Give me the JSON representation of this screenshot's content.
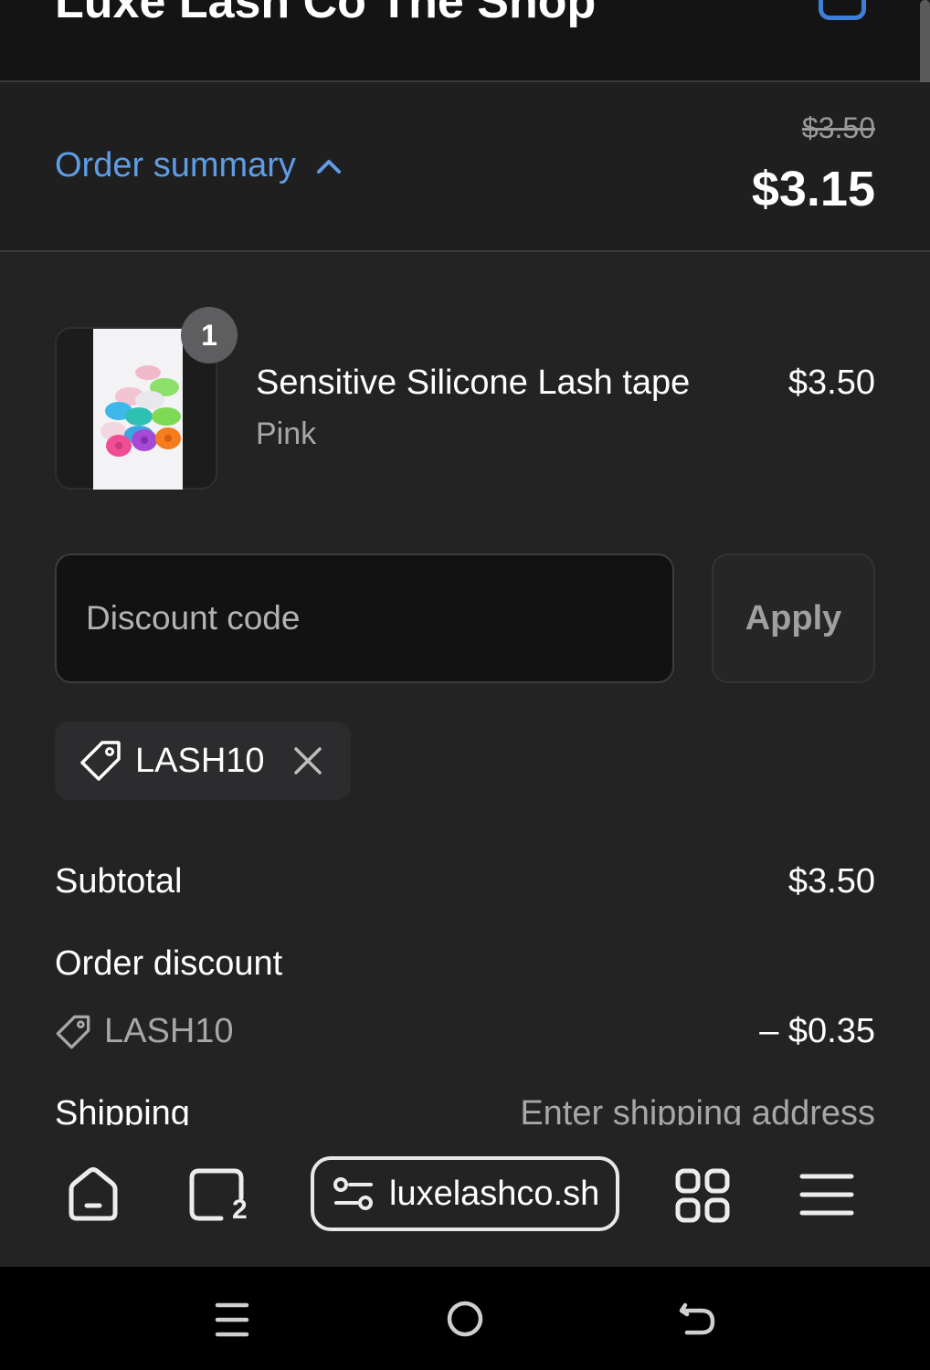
{
  "header": {
    "title": "Luxe Lash Co The Shop"
  },
  "summary": {
    "toggle_label": "Order summary",
    "original_total": "$3.50",
    "total": "$3.15"
  },
  "line_item": {
    "quantity": "1",
    "name": "Sensitive Silicone Lash tape",
    "variant": "Pink",
    "price": "$3.50"
  },
  "discount": {
    "placeholder": "Discount code",
    "apply_label": "Apply",
    "applied_code": "LASH10"
  },
  "totals": {
    "subtotal_label": "Subtotal",
    "subtotal_value": "$3.50",
    "order_discount_label": "Order discount",
    "discount_code": "LASH10",
    "discount_amount": "– $0.35",
    "shipping_label": "Shipping",
    "shipping_value": "Enter shipping address"
  },
  "browser": {
    "url": "luxelashco.sh",
    "tab_count": "2"
  },
  "colors": {
    "accent": "#5e9de6",
    "background": "#232324",
    "header_bg": "#141414"
  }
}
